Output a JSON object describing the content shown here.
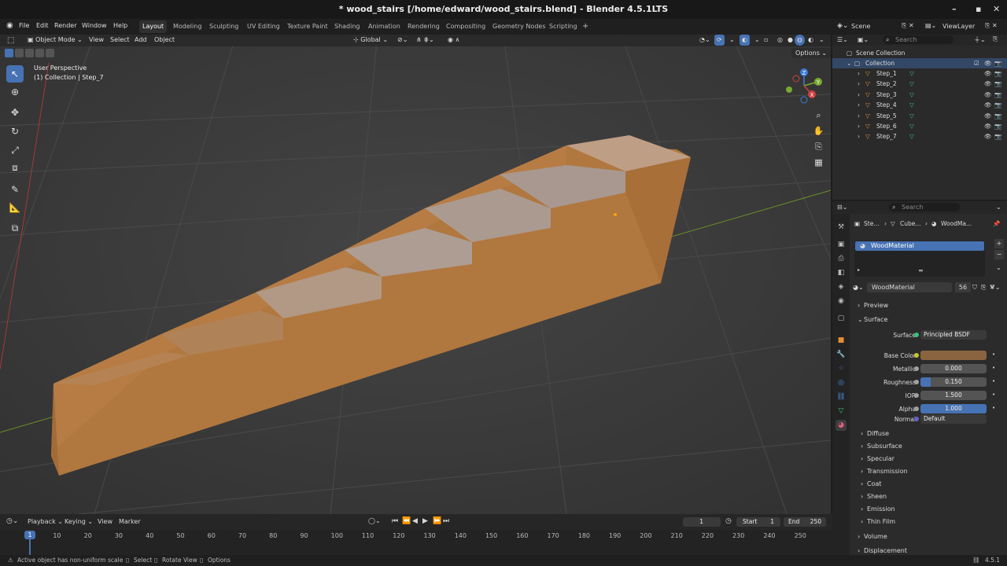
{
  "window": {
    "title": "* wood_stairs [/home/edward/wood_stairs.blend] - Blender 4.5.1LTS",
    "minimize": "–",
    "maximize": "▪",
    "close": "✕"
  },
  "menu": [
    "File",
    "Edit",
    "Render",
    "Window",
    "Help"
  ],
  "workspaces": [
    "Layout",
    "Modeling",
    "Sculpting",
    "UV Editing",
    "Texture Paint",
    "Shading",
    "Animation",
    "Rendering",
    "Compositing",
    "Geometry Nodes",
    "Scripting"
  ],
  "workspace_add": "+",
  "viewport": {
    "mode": "Object Mode",
    "header_menus": [
      "View",
      "Select",
      "Add",
      "Object"
    ],
    "orientation": "Global",
    "options": "Options",
    "overlay_line1": "User Perspective",
    "overlay_line2": "(1) Collection | Step_7",
    "gizmo": {
      "x": "X",
      "y": "Y",
      "z": "Z"
    }
  },
  "outliner": {
    "scene": "Scene",
    "view_layer": "ViewLayer",
    "search_placeholder": "Search",
    "scene_collection": "Scene Collection",
    "collection": "Collection",
    "items": [
      "Step_1",
      "Step_2",
      "Step_3",
      "Step_4",
      "Step_5",
      "Step_6",
      "Step_7"
    ]
  },
  "properties": {
    "search_placeholder": "Search",
    "breadcrumb": [
      "Ste...",
      "Cube...",
      "WoodMa..."
    ],
    "material_slot": "WoodMaterial",
    "material_name": "WoodMaterial",
    "user_count": "56",
    "preview": "Preview",
    "surface_panel": "Surface",
    "surface_label": "Surface",
    "surface_value": "Principled BSDF",
    "fields": [
      {
        "label": "Base Color",
        "value": ""
      },
      {
        "label": "Metallic",
        "value": "0.000"
      },
      {
        "label": "Roughness",
        "value": "0.150"
      },
      {
        "label": "IOR",
        "value": "1.500"
      },
      {
        "label": "Alpha",
        "value": "1.000"
      }
    ],
    "roughness_fraction": 0.15,
    "alpha_fraction": 1.0,
    "normal_label": "Normal",
    "normal_value": "Default",
    "subpanels": [
      "Diffuse",
      "Subsurface",
      "Specular",
      "Transmission",
      "Coat",
      "Sheen",
      "Emission",
      "Thin Film"
    ],
    "volume": "Volume",
    "displacement": "Displacement",
    "base_color_hex": "#8a6440"
  },
  "timeline": {
    "menus": [
      "Playback",
      "Keying",
      "View",
      "Marker"
    ],
    "current_frame": "1",
    "start_label": "Start",
    "start": "1",
    "end_label": "End",
    "end": "250",
    "ruler_ticks": [
      "10",
      "20",
      "30",
      "40",
      "50",
      "60",
      "70",
      "80",
      "90",
      "100",
      "110",
      "120",
      "130",
      "140",
      "150",
      "160",
      "170",
      "180",
      "190",
      "200",
      "210",
      "220",
      "230",
      "240",
      "250"
    ],
    "playhead": "1"
  },
  "status": {
    "message": "Active object has non-uniform scale",
    "hint_select": "Select",
    "hint_rotate": "Rotate View",
    "hint_options": "Options",
    "version": "4.5.1"
  },
  "colors": {
    "accent": "#4772b3",
    "wood": "#b57a45",
    "background": "#3a3a3a"
  }
}
